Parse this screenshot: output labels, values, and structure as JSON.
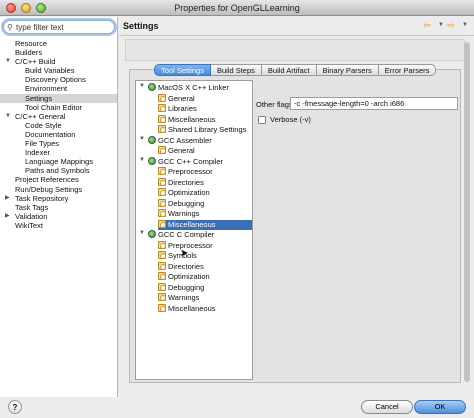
{
  "window": {
    "title": "Properties for OpenGLLearning"
  },
  "filter": {
    "placeholder": "type filter text",
    "value": "type filter text"
  },
  "left_tree": [
    {
      "label": "Resource",
      "indent": 1,
      "toggle": ""
    },
    {
      "label": "Builders",
      "indent": 1,
      "toggle": ""
    },
    {
      "label": "C/C++ Build",
      "indent": 1,
      "toggle": "▼"
    },
    {
      "label": "Build Variables",
      "indent": 2,
      "toggle": ""
    },
    {
      "label": "Discovery Options",
      "indent": 2,
      "toggle": ""
    },
    {
      "label": "Environment",
      "indent": 2,
      "toggle": ""
    },
    {
      "label": "Settings",
      "indent": 2,
      "toggle": "",
      "selected": true
    },
    {
      "label": "Tool Chain Editor",
      "indent": 2,
      "toggle": ""
    },
    {
      "label": "C/C++ General",
      "indent": 1,
      "toggle": "▼"
    },
    {
      "label": "Code Style",
      "indent": 2,
      "toggle": ""
    },
    {
      "label": "Documentation",
      "indent": 2,
      "toggle": ""
    },
    {
      "label": "File Types",
      "indent": 2,
      "toggle": ""
    },
    {
      "label": "Indexer",
      "indent": 2,
      "toggle": ""
    },
    {
      "label": "Language Mappings",
      "indent": 2,
      "toggle": ""
    },
    {
      "label": "Paths and Symbols",
      "indent": 2,
      "toggle": ""
    },
    {
      "label": "Project References",
      "indent": 1,
      "toggle": ""
    },
    {
      "label": "Run/Debug Settings",
      "indent": 1,
      "toggle": ""
    },
    {
      "label": "Task Repository",
      "indent": 1,
      "toggle": "▶"
    },
    {
      "label": "Task Tags",
      "indent": 1,
      "toggle": ""
    },
    {
      "label": "Validation",
      "indent": 1,
      "toggle": "▶"
    },
    {
      "label": "WikiText",
      "indent": 1,
      "toggle": ""
    }
  ],
  "settings": {
    "title": "Settings"
  },
  "tabs": [
    {
      "label": "Tool Settings",
      "active": true
    },
    {
      "label": "Build Steps",
      "active": false
    },
    {
      "label": "Build Artifact",
      "active": false
    },
    {
      "label": "Binary Parsers",
      "active": false
    },
    {
      "label": "Error Parsers",
      "active": false
    }
  ],
  "tool_tree": [
    {
      "label": "MacOS X C++ Linker",
      "type": "tool",
      "toggle": "▼"
    },
    {
      "label": "General",
      "type": "option"
    },
    {
      "label": "Libraries",
      "type": "option"
    },
    {
      "label": "Miscellaneous",
      "type": "option"
    },
    {
      "label": "Shared Library Settings",
      "type": "option"
    },
    {
      "label": "GCC Assembler",
      "type": "tool",
      "toggle": "▼"
    },
    {
      "label": "General",
      "type": "option"
    },
    {
      "label": "GCC C++ Compiler",
      "type": "tool",
      "toggle": "▼"
    },
    {
      "label": "Preprocessor",
      "type": "option"
    },
    {
      "label": "Directories",
      "type": "option"
    },
    {
      "label": "Optimization",
      "type": "option"
    },
    {
      "label": "Debugging",
      "type": "option"
    },
    {
      "label": "Warnings",
      "type": "option"
    },
    {
      "label": "Miscellaneous",
      "type": "option",
      "selected": true
    },
    {
      "label": "GCC C Compiler",
      "type": "tool",
      "toggle": "▼"
    },
    {
      "label": "Preprocessor",
      "type": "option"
    },
    {
      "label": "Symbols",
      "type": "option"
    },
    {
      "label": "Directories",
      "type": "option"
    },
    {
      "label": "Optimization",
      "type": "option"
    },
    {
      "label": "Debugging",
      "type": "option"
    },
    {
      "label": "Warnings",
      "type": "option"
    },
    {
      "label": "Miscellaneous",
      "type": "option"
    }
  ],
  "options": {
    "other_flags_label": "Other flags",
    "other_flags_value": "-c -fmessage-length=0 -arch i686",
    "verbose_label": "Verbose (-v)",
    "verbose_checked": false
  },
  "footer": {
    "help_label": "?",
    "cancel_label": "Cancel",
    "ok_label": "OK"
  }
}
